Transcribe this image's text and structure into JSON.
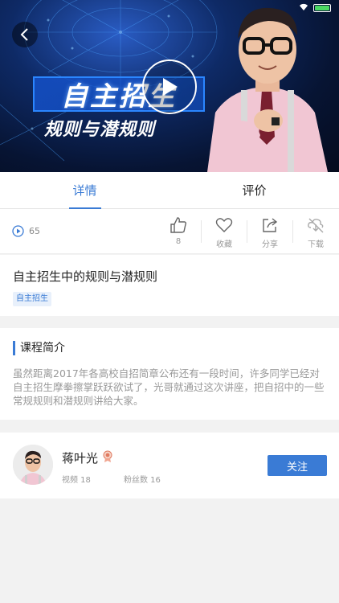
{
  "status_bar": {
    "carrier": "●●●",
    "time": "",
    "battery_label": ""
  },
  "hero": {
    "banner_title": "自主招生",
    "banner_subtitle": "规则与潜规则"
  },
  "tabs": [
    {
      "label": "详情",
      "active": true
    },
    {
      "label": "评价",
      "active": false
    }
  ],
  "stats": {
    "play_count": "65",
    "actions": [
      {
        "name": "like",
        "label": "8"
      },
      {
        "name": "favorite",
        "label": "收藏"
      },
      {
        "name": "share",
        "label": "分享"
      },
      {
        "name": "download",
        "label": "下载"
      }
    ]
  },
  "course": {
    "title": "自主招生中的规则与潜规则",
    "tag": "自主招生"
  },
  "intro": {
    "heading": "课程简介",
    "text": "虽然距离2017年各高校自招简章公布还有一段时间，许多同学已经对自主招生摩拳擦掌跃跃欲试了，光哥就通过这次讲座，把自招中的一些常规规则和潜规则讲给大家。"
  },
  "author": {
    "name": "蒋叶光",
    "videos": "视频 18",
    "fans": "粉丝数 16",
    "follow_label": "关注"
  },
  "colors": {
    "accent": "#3a7bd5",
    "page_bg": "#f2f2f2"
  }
}
